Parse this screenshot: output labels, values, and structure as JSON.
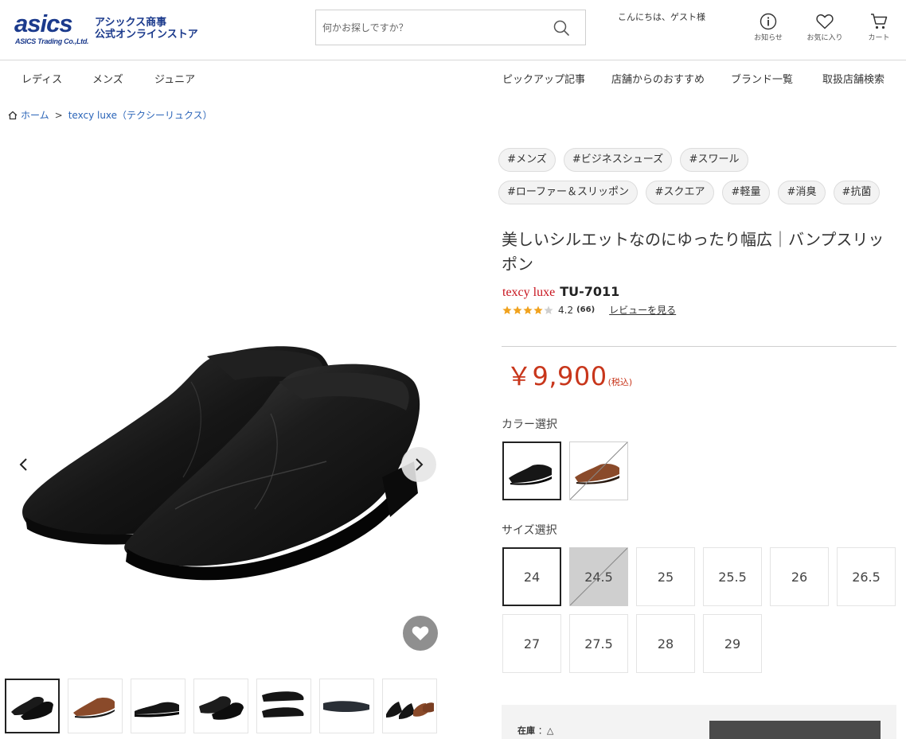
{
  "header": {
    "logo_text": "asics",
    "logo_sub": "ASICS Trading Co.,Ltd.",
    "store_name_line1": "アシックス商事",
    "store_name_line2": "公式オンラインストア",
    "search_placeholder": "何かお探しですか？",
    "greeting": "こんにちは、ゲスト様",
    "notice_label": "お知らせ",
    "favorites_label": "お気に入り",
    "cart_label": "カート"
  },
  "nav": {
    "left": [
      "レディス",
      "メンズ",
      "ジュニア"
    ],
    "right": [
      "ピックアップ記事",
      "店舗からのおすすめ",
      "ブランド一覧",
      "取扱店舗検索"
    ]
  },
  "breadcrumb": {
    "home": "ホーム",
    "separator": ">",
    "current": "texcy luxe（テクシーリュクス）"
  },
  "product": {
    "tags_row1": [
      "#メンズ",
      "#ビジネスシューズ",
      "#スワール"
    ],
    "tags_row2": [
      "#ローファー＆スリッポン",
      "#スクエア",
      "#軽量",
      "#消臭",
      "#抗菌"
    ],
    "title": "美しいシルエットなのにゆったり幅広｜バンプスリッポン",
    "brand": "texcy luxe",
    "model": "TU-7011",
    "rating": 4.2,
    "rating_text": "4.2",
    "review_count": "(66)",
    "review_link": "レビューを見る",
    "price": "￥9,900",
    "price_tax": "(税込)",
    "color_label": "カラー選択",
    "colors": [
      {
        "name": "black",
        "selected": true,
        "available": true
      },
      {
        "name": "brown",
        "selected": false,
        "available": false
      }
    ],
    "size_label": "サイズ選択",
    "sizes": [
      "24",
      "24.5",
      "25",
      "25.5",
      "26",
      "26.5",
      "27",
      "27.5",
      "28",
      "29"
    ],
    "selected_size": "24",
    "unavailable_sizes": [
      "24.5"
    ],
    "stock_label": "在庫",
    "stock_value": "：△"
  },
  "gallery": {
    "thumbnail_count": 7,
    "selected_index": 0
  },
  "colors": {
    "brand_blue": "#1b3a8c",
    "price_red": "#c8361b",
    "brand_red": "#c8141e",
    "link_blue": "#2a64b8",
    "star_gold": "#f0a21e"
  }
}
